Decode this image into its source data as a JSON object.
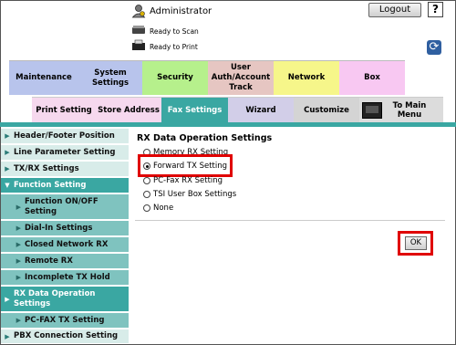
{
  "header": {
    "user_label": "Administrator",
    "logout_label": "Logout",
    "help_label": "?",
    "status_scan": "Ready to Scan",
    "status_print": "Ready to Print"
  },
  "top_tabs": [
    {
      "label": "Maintenance",
      "color": "#b8c4ec"
    },
    {
      "label": "System Settings",
      "color": "#b8c4ec"
    },
    {
      "label": "Security",
      "color": "#b6f08c"
    },
    {
      "label": "User Auth/Account Track",
      "color": "#e6c6c2"
    },
    {
      "label": "Network",
      "color": "#f6f68a"
    },
    {
      "label": "Box",
      "color": "#f8c8f2"
    }
  ],
  "sub_tabs": [
    {
      "label": "Print Setting"
    },
    {
      "label": "Store Address"
    },
    {
      "label": "Fax Settings",
      "active": true
    },
    {
      "label": "Wizard"
    },
    {
      "label": "Customize"
    },
    {
      "label": "To Main Menu"
    }
  ],
  "sidebar": {
    "items": [
      {
        "label": "Header/Footer Position"
      },
      {
        "label": "Line Parameter Setting"
      },
      {
        "label": "TX/RX Settings"
      },
      {
        "label": "Function Setting"
      },
      {
        "label": "Function ON/OFF Setting"
      },
      {
        "label": "Dial-In Settings"
      },
      {
        "label": "Closed Network RX"
      },
      {
        "label": "Remote RX"
      },
      {
        "label": "Incomplete TX Hold"
      },
      {
        "label": "RX Data Operation Settings"
      },
      {
        "label": "PC-FAX TX Setting"
      },
      {
        "label": "PBX Connection Setting"
      }
    ]
  },
  "main": {
    "title": "RX Data Operation Settings",
    "options": [
      {
        "label": "Memory RX Setting",
        "selected": false
      },
      {
        "label": "Forward TX Setting",
        "selected": true
      },
      {
        "label": "PC-Fax RX Setting",
        "selected": false
      },
      {
        "label": "TSI User Box Settings",
        "selected": false
      },
      {
        "label": "None",
        "selected": false
      }
    ],
    "ok_label": "OK"
  },
  "colors": {
    "accent_teal": "#3aa7a2",
    "highlight_red": "#e00000"
  }
}
